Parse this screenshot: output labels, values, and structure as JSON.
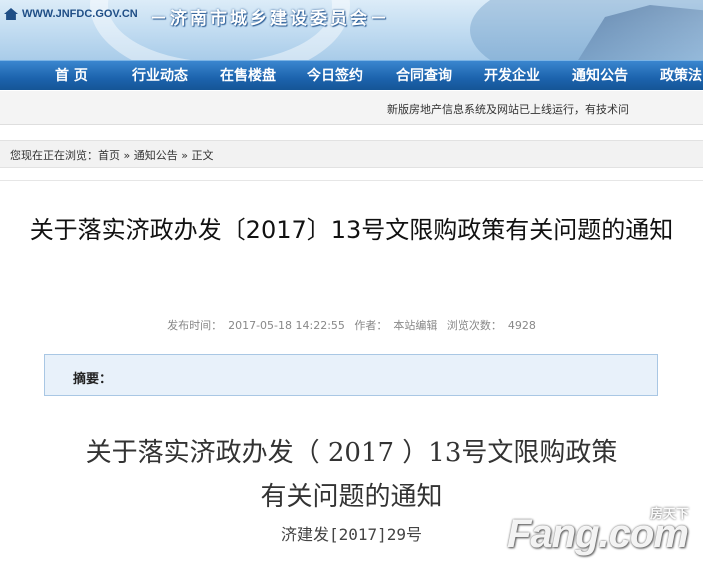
{
  "header": {
    "url": "WWW.JNFDC.GOV.CN",
    "site_title": "－济南市城乡建设委员会－"
  },
  "nav": {
    "items": [
      {
        "label": "首 页"
      },
      {
        "label": "行业动态"
      },
      {
        "label": "在售楼盘"
      },
      {
        "label": "今日签约"
      },
      {
        "label": "合同查询"
      },
      {
        "label": "开发企业"
      },
      {
        "label": "通知公告"
      },
      {
        "label": "政策法"
      }
    ]
  },
  "ticker": {
    "text": "新版房地产信息系统及网站已上线运行，有技术问"
  },
  "breadcrumb": {
    "prefix": "您现在正在浏览：",
    "home": "首页",
    "sep1": " » ",
    "section": "通知公告",
    "sep2": " » ",
    "current": "正文"
  },
  "article": {
    "title": "关于落实济政办发〔2017〕13号文限购政策有关问题的通知",
    "meta": {
      "published_label": "发布时间：",
      "published_value": "2017-05-18 14:22:55",
      "author_label": "作者：",
      "author_value": "本站编辑",
      "views_label": "浏览次数：",
      "views_value": "4928"
    },
    "summary_label": "摘要：",
    "doc_heading_line1": "关于落实济政办发（ 2017 ）13号文限购政策",
    "doc_heading_line2": "有关问题的通知",
    "doc_number": "济建发[2017]29号"
  },
  "watermark": {
    "main": "Fang.com",
    "sub": "房天下"
  }
}
